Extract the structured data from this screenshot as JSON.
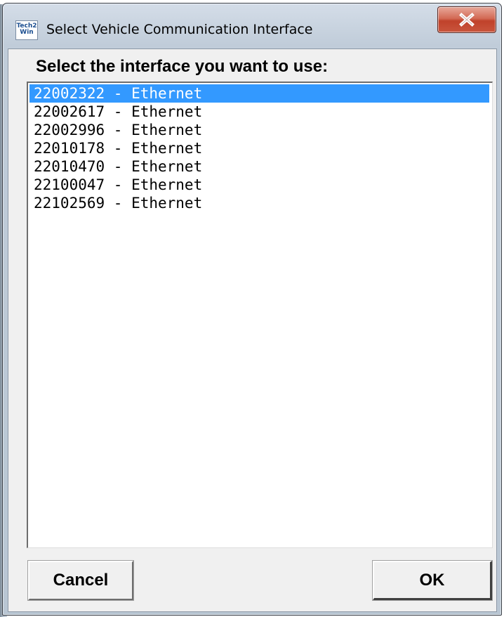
{
  "window": {
    "title": "Select Vehicle Communication Interface",
    "app_icon_text_top": "Tech2",
    "app_icon_text_bottom": "Win"
  },
  "prompt": "Select the interface you want to use:",
  "interfaces": [
    {
      "label": "22002322 - Ethernet",
      "selected": true
    },
    {
      "label": "22002617 - Ethernet",
      "selected": false
    },
    {
      "label": "22002996 - Ethernet",
      "selected": false
    },
    {
      "label": "22010178 - Ethernet",
      "selected": false
    },
    {
      "label": "22010470 - Ethernet",
      "selected": false
    },
    {
      "label": "22100047 - Ethernet",
      "selected": false
    },
    {
      "label": "22102569 - Ethernet",
      "selected": false
    }
  ],
  "buttons": {
    "cancel_label": "Cancel",
    "ok_label": "OK"
  },
  "colors": {
    "selection": "#3399ff",
    "close_button": "#c9553d"
  },
  "icons": {
    "app": "tech2win-app-icon",
    "close": "close-icon"
  }
}
